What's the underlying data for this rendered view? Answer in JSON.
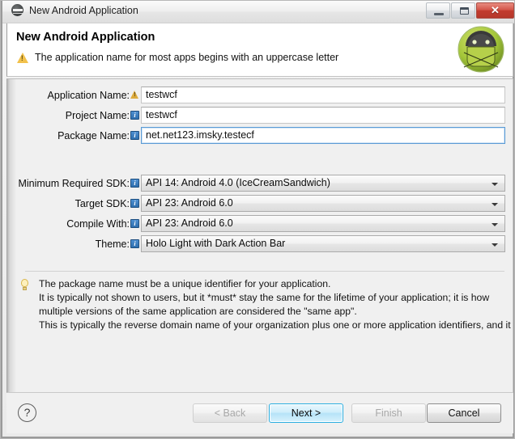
{
  "window": {
    "title": "New Android Application",
    "app_icon": "android-icon",
    "controls": {
      "minimize": "minimize-icon",
      "maximize": "maximize-icon",
      "close": "✕"
    }
  },
  "header": {
    "title": "New Android Application",
    "warning_icon": "warning-icon",
    "message": "The application name for most apps begins with an uppercase letter",
    "brand_icon": "android-robot-icon"
  },
  "form": {
    "fields": [
      {
        "label": "Application Name:",
        "badge": "warn",
        "badge_icon": "warning-badge-icon",
        "type": "text",
        "value": "testwcf",
        "focused": false,
        "name": "application-name"
      },
      {
        "label": "Project Name:",
        "badge": "info",
        "badge_icon": "info-badge-icon",
        "type": "text",
        "value": "testwcf",
        "focused": false,
        "name": "project-name"
      },
      {
        "label": "Package Name:",
        "badge": "info",
        "badge_icon": "info-badge-icon",
        "type": "text",
        "value": "net.net123.imsky.testecf",
        "focused": true,
        "name": "package-name"
      }
    ],
    "dropdowns": [
      {
        "label": "Minimum Required SDK:",
        "badge": "info",
        "badge_icon": "info-badge-icon",
        "value": "API 14: Android 4.0 (IceCreamSandwich)",
        "name": "minimum-required-sdk"
      },
      {
        "label": "Target SDK:",
        "badge": "info",
        "badge_icon": "info-badge-icon",
        "value": "API 23: Android 6.0",
        "name": "target-sdk"
      },
      {
        "label": "Compile With:",
        "badge": "info",
        "badge_icon": "info-badge-icon",
        "value": "API 23: Android 6.0",
        "name": "compile-with"
      },
      {
        "label": "Theme:",
        "badge": "info",
        "badge_icon": "info-badge-icon",
        "value": "Holo Light with Dark Action Bar",
        "name": "theme"
      }
    ]
  },
  "tip": {
    "icon": "lightbulb-icon",
    "lines": [
      "The package name must be a unique identifier for your application.",
      "It is typically not shown to users, but it *must* stay the same for the lifetime of your application; it is how",
      "multiple versions of the same application are considered the \"same app\".",
      "This is typically the reverse domain name of your organization plus one or more application identifiers, and it"
    ]
  },
  "buttons": {
    "help": "?",
    "back": "< Back",
    "next": "Next >",
    "finish": "Finish",
    "cancel": "Cancel"
  },
  "colors": {
    "accent": "#2aaee0",
    "android_green": "#a4c639",
    "warning": "#f2c14b",
    "info_blue": "#2f6fae",
    "close_red": "#c23b2e"
  }
}
